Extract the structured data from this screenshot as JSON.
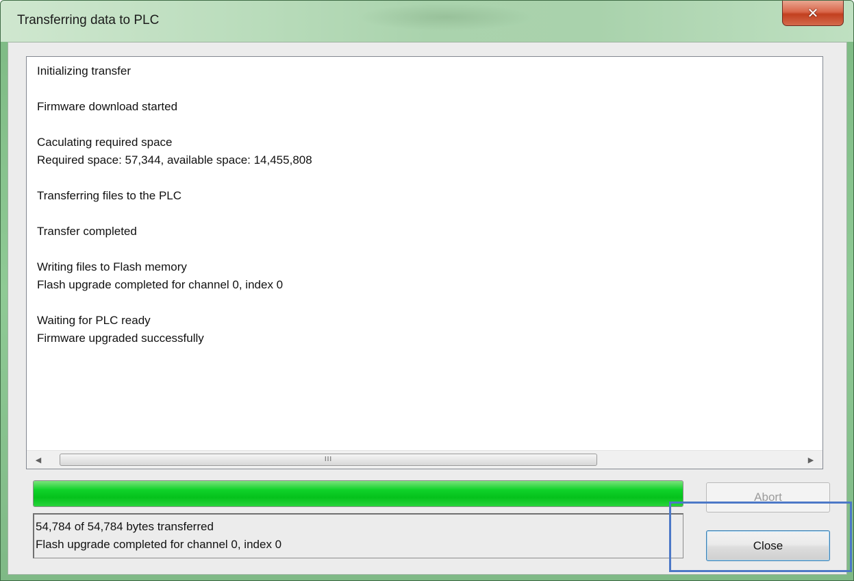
{
  "window": {
    "title": "Transferring data to PLC",
    "close_icon": "close-x-icon"
  },
  "log": {
    "lines": [
      "Initializing transfer",
      "",
      "Firmware download started",
      "",
      "Caculating required space",
      "Required space: 57,344, available space: 14,455,808",
      "",
      "Transferring files to the PLC",
      "",
      "Transfer completed",
      "",
      "Writing files to Flash memory",
      "Flash upgrade completed for channel 0, index 0",
      "",
      "Waiting for PLC ready",
      "Firmware upgraded successfully"
    ],
    "scrollbar": {
      "left_icon": "scroll-left-arrow-icon",
      "right_icon": "scroll-right-arrow-icon",
      "grip": "III"
    }
  },
  "progress": {
    "fraction": 1.0
  },
  "status": {
    "line1": "54,784 of 54,784 bytes transferred",
    "line2": "Flash upgrade completed for channel 0, index 0"
  },
  "buttons": {
    "abort_label": "Abort",
    "close_label": "Close"
  },
  "colors": {
    "progress_fill": "#05c21c",
    "highlight_border": "#4c78c7",
    "close_button_accent": "#3c7fb1"
  }
}
